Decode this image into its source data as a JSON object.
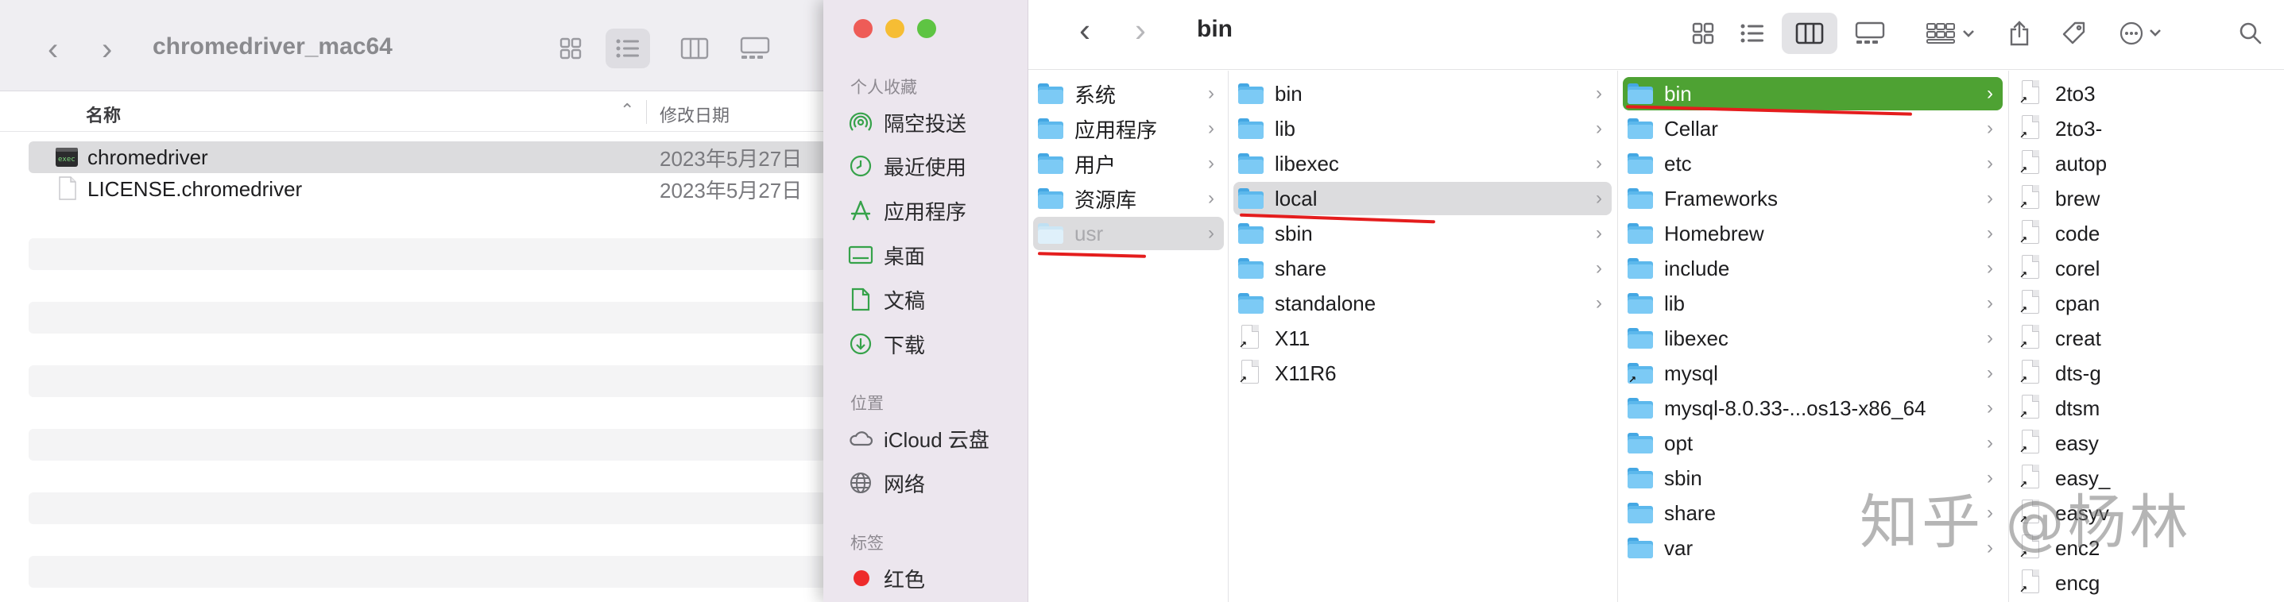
{
  "back_window": {
    "title": "chromedriver_mac64",
    "columns": {
      "name": "名称",
      "date": "修改日期"
    },
    "files": [
      {
        "name": "chromedriver",
        "date": "2023年5月27日",
        "selected": true,
        "icon": "terminal-exec-icon"
      },
      {
        "name": "LICENSE.chromedriver",
        "date": "2023年5月27日",
        "selected": false,
        "icon": "document-icon"
      }
    ]
  },
  "front_window": {
    "title": "bin",
    "sidebar": {
      "sections": [
        {
          "title": "个人收藏",
          "items": [
            {
              "label": "隔空投送",
              "icon": "airdrop-icon"
            },
            {
              "label": "最近使用",
              "icon": "clock-icon"
            },
            {
              "label": "应用程序",
              "icon": "applications-icon"
            },
            {
              "label": "桌面",
              "icon": "desktop-icon"
            },
            {
              "label": "文稿",
              "icon": "document-icon"
            },
            {
              "label": "下载",
              "icon": "download-icon"
            }
          ]
        },
        {
          "title": "位置",
          "items": [
            {
              "label": "iCloud 云盘",
              "icon": "cloud-icon"
            },
            {
              "label": "网络",
              "icon": "globe-icon"
            }
          ]
        },
        {
          "title": "标签",
          "items": [
            {
              "label": "红色",
              "icon": "red-tag-dot",
              "color": "#ee2b2b"
            }
          ]
        }
      ]
    },
    "column1": [
      {
        "label": "系统",
        "type": "folder"
      },
      {
        "label": "应用程序",
        "type": "folder"
      },
      {
        "label": "用户",
        "type": "folder"
      },
      {
        "label": "资源库",
        "type": "folder"
      },
      {
        "label": "usr",
        "type": "folder",
        "state": "highlighted-dim"
      }
    ],
    "column2": [
      {
        "label": "bin",
        "type": "folder"
      },
      {
        "label": "lib",
        "type": "folder"
      },
      {
        "label": "libexec",
        "type": "folder"
      },
      {
        "label": "local",
        "type": "folder",
        "state": "highlighted"
      },
      {
        "label": "sbin",
        "type": "folder"
      },
      {
        "label": "share",
        "type": "folder"
      },
      {
        "label": "standalone",
        "type": "folder"
      },
      {
        "label": "X11",
        "type": "alias"
      },
      {
        "label": "X11R6",
        "type": "alias"
      }
    ],
    "column3": [
      {
        "label": "bin",
        "type": "folder",
        "state": "selected"
      },
      {
        "label": "Cellar",
        "type": "folder"
      },
      {
        "label": "etc",
        "type": "folder"
      },
      {
        "label": "Frameworks",
        "type": "folder"
      },
      {
        "label": "Homebrew",
        "type": "folder"
      },
      {
        "label": "include",
        "type": "folder"
      },
      {
        "label": "lib",
        "type": "folder"
      },
      {
        "label": "libexec",
        "type": "folder"
      },
      {
        "label": "mysql",
        "type": "folder-alias"
      },
      {
        "label": "mysql-8.0.33-...os13-x86_64",
        "type": "folder"
      },
      {
        "label": "opt",
        "type": "folder"
      },
      {
        "label": "sbin",
        "type": "folder"
      },
      {
        "label": "share",
        "type": "folder"
      },
      {
        "label": "var",
        "type": "folder"
      }
    ],
    "column4": [
      "2to3",
      "2to3-",
      "autop",
      "brew",
      "code",
      "corel",
      "cpan",
      "creat",
      "dts-g",
      "dtsm",
      "easy",
      "easy_",
      "easyv",
      "enc2",
      "encg"
    ]
  },
  "colors": {
    "selection_green": "#4ea233",
    "annotation_red": "#e41d1d",
    "folder_blue": "#5cb8ec",
    "sidebar_bg": "#ece6ee"
  },
  "watermark": "知乎 @杨林"
}
